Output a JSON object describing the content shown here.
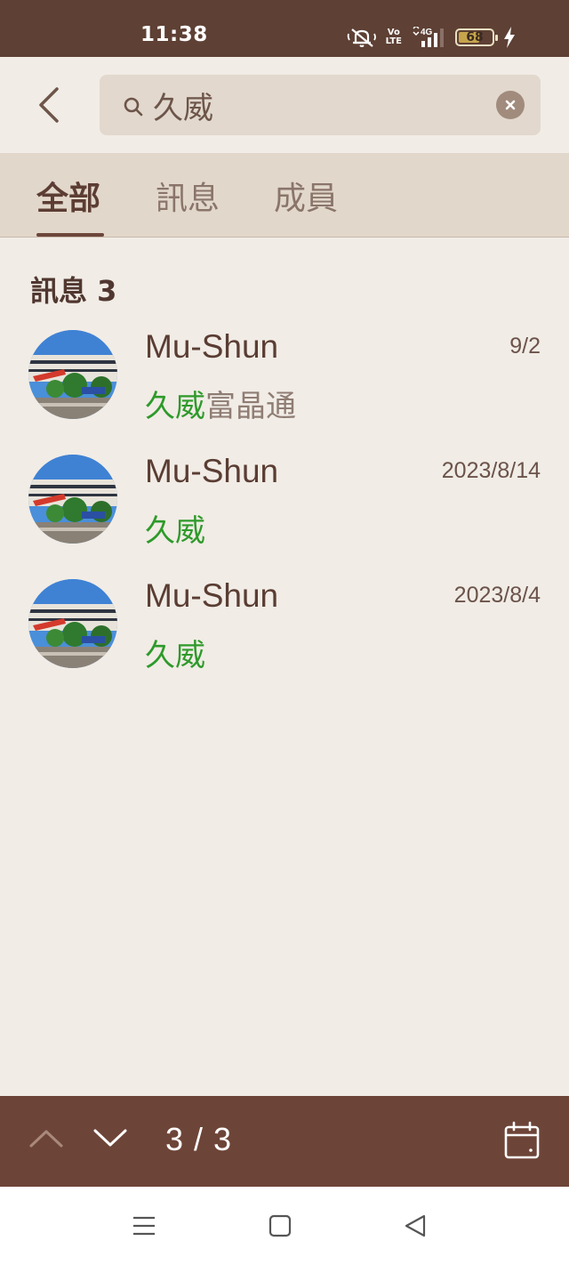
{
  "status_bar": {
    "time": "11:38",
    "volte_top": "Vo",
    "volte_bottom": "LTE",
    "network": "4G",
    "battery": "68",
    "battery_level": 0.68
  },
  "search": {
    "query": "久威",
    "placeholder": ""
  },
  "tabs": [
    {
      "label": "全部",
      "active": true
    },
    {
      "label": "訊息",
      "active": false
    },
    {
      "label": "成員",
      "active": false
    }
  ],
  "section": {
    "title": "訊息 3"
  },
  "results": [
    {
      "name": "Mu-Shun",
      "date": "9/2",
      "match": "久威",
      "rest": "富晶通"
    },
    {
      "name": "Mu-Shun",
      "date": "2023/8/14",
      "match": "久威",
      "rest": ""
    },
    {
      "name": "Mu-Shun",
      "date": "2023/8/4",
      "match": "久威",
      "rest": ""
    }
  ],
  "bottom_bar": {
    "counter": "3 / 3"
  },
  "colors": {
    "header": "#5e4034",
    "bottom_bar": "#6d4538",
    "background": "#f1ece6",
    "highlight": "#2e9a2a"
  }
}
